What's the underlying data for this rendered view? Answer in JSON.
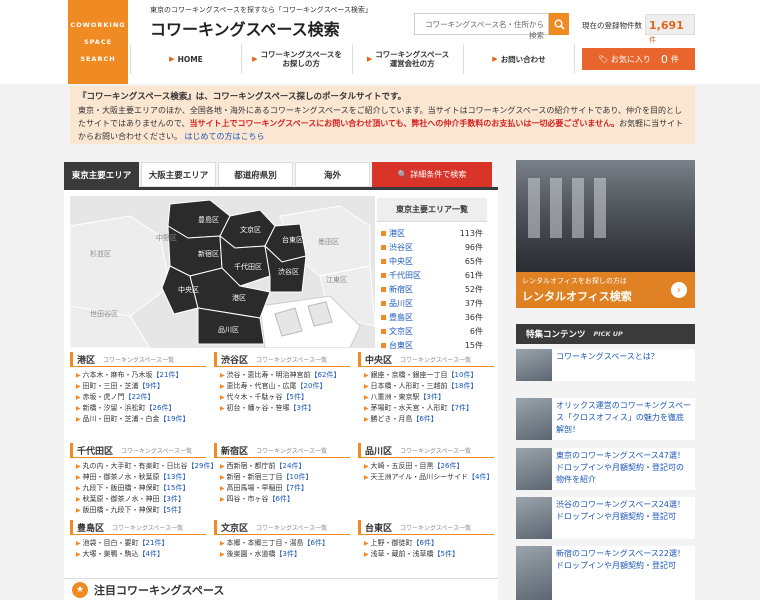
{
  "logo": {
    "lines": [
      "COWORKING",
      "SPACE",
      "SEARCH"
    ]
  },
  "header": {
    "tagline": "東京のコワーキングスペースを探すなら「コワーキングスペース検索」",
    "title": "コワーキングスペース検索",
    "search_placeholder": "コワーキングスペース名・住所から検索",
    "count_label": "現在の登録物件数",
    "count_value": "1,691",
    "count_unit": "件"
  },
  "nav": [
    {
      "label": "HOME"
    },
    {
      "label": "コワーキングスペースを\nお探しの方"
    },
    {
      "label": "コワーキングスペース\n運営会社の方"
    },
    {
      "label": "お問い合わせ"
    }
  ],
  "favorite": {
    "label": "お気に入り",
    "count": "0",
    "unit": "件"
  },
  "intro": {
    "heading": "『コワーキングスペース検索』は、コワーキングスペース探しのポータルサイトです。",
    "p1": "東京・大阪主要エリアのほか、全国各地・海外にあるコワーキングスペースをご紹介しています。当サイトはコワーキングスペースの紹介サイトであり、仲介を目的としたサイトではありませんので、",
    "red": "当サイト上でコワーキングスペースにお問い合わせ頂いても、弊社への仲介手数料のお支払いは一切必要ございません。",
    "p2": "お気軽に当サイトからお問い合わせください。",
    "link": "はじめての方はこちら"
  },
  "tabs": [
    "東京主要エリア",
    "大阪主要エリア",
    "都道府県別",
    "海外",
    "詳細条件で検索"
  ],
  "map": {
    "dark": [
      "豊島区",
      "文京区",
      "台東区",
      "新宿区",
      "千代田区",
      "渋谷区",
      "中央区",
      "港区",
      "品川区"
    ],
    "light": [
      "中野区",
      "杉並区",
      "世田谷区",
      "墨田区",
      "江東区"
    ]
  },
  "area_list": {
    "title": "東京主要エリア一覧",
    "items": [
      {
        "name": "港区",
        "count": "113件"
      },
      {
        "name": "渋谷区",
        "count": "96件"
      },
      {
        "name": "中央区",
        "count": "65件"
      },
      {
        "name": "千代田区",
        "count": "61件"
      },
      {
        "name": "新宿区",
        "count": "52件"
      },
      {
        "name": "品川区",
        "count": "37件"
      },
      {
        "name": "豊島区",
        "count": "36件"
      },
      {
        "name": "文京区",
        "count": "6件"
      },
      {
        "name": "台東区",
        "count": "15件"
      }
    ]
  },
  "sections": [
    {
      "name": "港区",
      "items": [
        [
          "六本木・麻布・乃木坂",
          "21件"
        ],
        [
          "田町・三田・芝浦",
          "9件"
        ],
        [
          "赤坂・虎ノ門",
          "22件"
        ],
        [
          "新橋・汐留・浜松町",
          "26件"
        ],
        [
          "品川・田町・芝浦・白金",
          "19件"
        ]
      ]
    },
    {
      "name": "渋谷区",
      "items": [
        [
          "渋谷・恵比寿・明治神宮前",
          "62件"
        ],
        [
          "恵比寿・代官山・広尾",
          "20件"
        ],
        [
          "代々木・千駄ヶ谷",
          "5件"
        ],
        [
          "初台・幡ヶ谷・笹塚",
          "3件"
        ]
      ]
    },
    {
      "name": "中央区",
      "items": [
        [
          "銀座・京橋・銀座一丁目",
          "10件"
        ],
        [
          "日本橋・人形町・三越前",
          "18件"
        ],
        [
          "八重洲・東京駅",
          "3件"
        ],
        [
          "茅場町・水天宮・人形町",
          "7件"
        ],
        [
          "勝どき・月島",
          "6件"
        ]
      ]
    },
    {
      "name": "千代田区",
      "items": [
        [
          "丸の内・大手町・有楽町・日比谷",
          "29件"
        ],
        [
          "神田・御茶ノ水・秋葉原",
          "13件"
        ],
        [
          "九段下・飯田橋・神保町",
          "15件"
        ],
        [
          "秋葉原・御茶ノ水・神田",
          "3件"
        ],
        [
          "飯田橋・九段下・神保町",
          "5件"
        ]
      ]
    },
    {
      "name": "新宿区",
      "items": [
        [
          "西新宿・都庁前",
          "24件"
        ],
        [
          "新宿・新宿三丁目",
          "10件"
        ],
        [
          "高田馬場・早稲田",
          "7件"
        ],
        [
          "四谷・市ヶ谷",
          "6件"
        ]
      ]
    },
    {
      "name": "品川区",
      "items": [
        [
          "大崎・五反田・目黒",
          "26件"
        ],
        [
          "天王洲アイル・品川シーサイド",
          "4件"
        ]
      ]
    },
    {
      "name": "豊島区",
      "items": [
        [
          "池袋・目白・要町",
          "21件"
        ],
        [
          "大塚・巣鴨・駒込",
          "4件"
        ]
      ]
    },
    {
      "name": "文京区",
      "items": [
        [
          "本郷・本郷三丁目・湯島",
          "6件"
        ],
        [
          "後楽園・水道橋",
          "3件"
        ]
      ]
    },
    {
      "name": "台東区",
      "items": [
        [
          "上野・御徒町",
          "6件"
        ],
        [
          "浅草・蔵前・浅草橋",
          "5件"
        ]
      ]
    }
  ],
  "section_sub": "コワーキングスペース一覧",
  "pickup_heading": "注目コワーキングスペース",
  "rental": {
    "line1": "レンタルオフィスをお探しの方は",
    "line2": "レンタルオフィス検索"
  },
  "featured": {
    "title": "特集コンテンツ",
    "sub": "PICK UP",
    "items": [
      "コワーキングスペースとは？",
      "オリックス運営のコワーキングスペース「クロスオフィス」の魅力を徹底解剖！",
      "東京のコワーキングスペース47選！ドロップインや月額契約・登記可の物件を紹介",
      "渋谷のコワーキングスペース24選！ドロップインや月額契約・登記可",
      "新宿のコワーキングスペース22選！ドロップインや月額契約・登記可"
    ]
  }
}
